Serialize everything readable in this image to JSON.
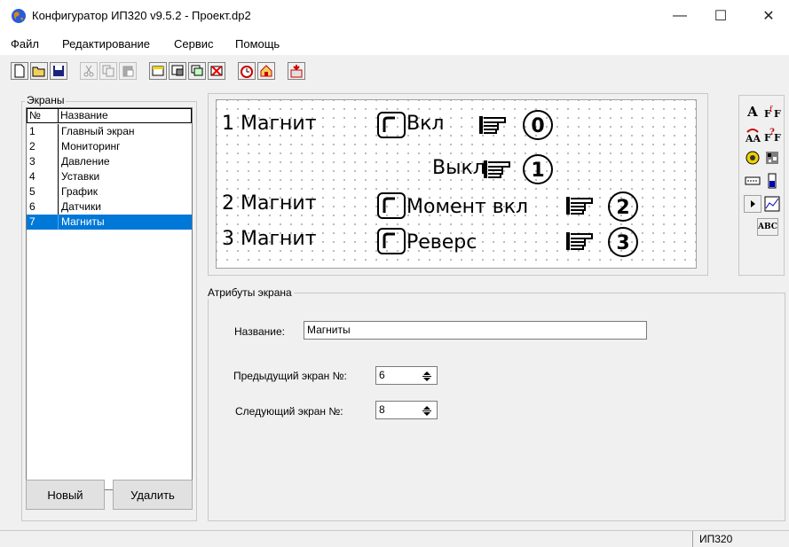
{
  "window": {
    "title": "Конфигуратор ИП320 v9.5.2 - Проект.dp2",
    "minimize": "—",
    "maximize": "☐",
    "close": "✕"
  },
  "menu": [
    "Файл",
    "Редактирование",
    "Сервис",
    "Помощь"
  ],
  "toolbar": {
    "icons": [
      "new-file-icon",
      "open-folder-icon",
      "save-icon",
      "cut-icon",
      "copy-icon",
      "paste-icon",
      "add-screen-icon",
      "screen-settings-icon",
      "screen-copy-icon",
      "delete-screen-icon",
      "alarm-clock-icon",
      "home-icon",
      "transfer-icon"
    ]
  },
  "screens_panel": {
    "label": "Экраны",
    "columns": [
      "№",
      "Название"
    ],
    "rows": [
      {
        "num": "1",
        "name": "Главный экран"
      },
      {
        "num": "2",
        "name": "Мониторинг"
      },
      {
        "num": "3",
        "name": "Давление"
      },
      {
        "num": "4",
        "name": "Уставки"
      },
      {
        "num": "5",
        "name": "График"
      },
      {
        "num": "6",
        "name": "Датчики"
      },
      {
        "num": "7",
        "name": "Магниты"
      }
    ],
    "new_button": "Новый",
    "delete_button": "Удалить"
  },
  "canvas": {
    "texts": {
      "m1": "1 Магнит",
      "vkl": "Вкл",
      "vykl": "Выкл",
      "m2": "2 Магнит",
      "moment": "Момент вкл",
      "m3": "3 Магнит",
      "revers": "Реверс",
      "k0": "0",
      "k1": "1",
      "k2": "2",
      "k3": "3"
    }
  },
  "palette": {
    "icons": [
      "text-tool-icon",
      "formula-text-icon",
      "variable-text-icon",
      "formula-var-icon",
      "indicator-icon",
      "bitmap-icon",
      "numeric-field-icon",
      "bar-icon",
      "button-icon",
      "graph-icon",
      "abc-icon"
    ],
    "text_label": "A",
    "abc_label": "ABC"
  },
  "attributes": {
    "label": "Атрибуты экрана",
    "name_label": "Название:",
    "name_value": "Магниты",
    "prev_label": "Предыдущий экран №:",
    "prev_value": "6",
    "next_label": "Следующий экран №:",
    "next_value": "8"
  },
  "status": {
    "device": "ИП320"
  }
}
